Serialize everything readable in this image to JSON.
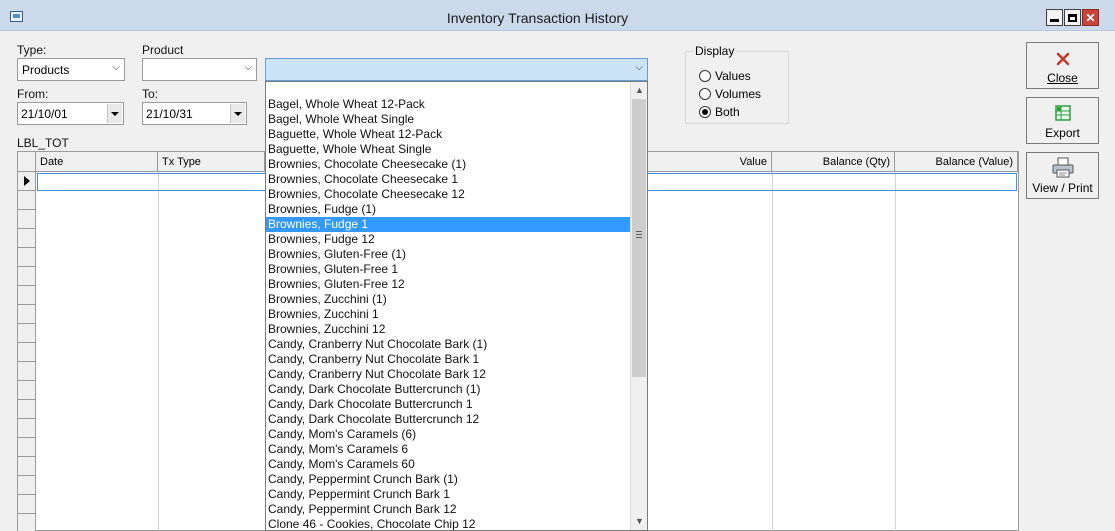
{
  "window": {
    "title": "Inventory Transaction History"
  },
  "filters": {
    "type_label": "Type:",
    "type_value": "Products",
    "product_label": "Product",
    "product_value": "",
    "product2_value": "",
    "from_label": "From:",
    "from_value": "21/10/01",
    "to_label": "To:",
    "to_value": "21/10/31"
  },
  "display": {
    "legend": "Display",
    "options": [
      "Values",
      "Volumes",
      "Both"
    ],
    "selected": "Both"
  },
  "total_label": "LBL_TOT",
  "grid": {
    "columns": [
      "Date",
      "Tx Type",
      "Value",
      "Balance (Qty)",
      "Balance (Value)"
    ]
  },
  "dropdown": {
    "selected": "Brownies, Fudge 1",
    "items": [
      "",
      "Bagel, Whole Wheat 12-Pack",
      "Bagel, Whole Wheat Single",
      "Baguette, Whole Wheat 12-Pack",
      "Baguette, Whole Wheat Single",
      "Brownies, Chocolate Cheesecake (1)",
      "Brownies, Chocolate Cheesecake 1",
      "Brownies, Chocolate Cheesecake 12",
      "Brownies, Fudge (1)",
      "Brownies, Fudge 1",
      "Brownies, Fudge 12",
      "Brownies, Gluten-Free  (1)",
      "Brownies, Gluten-Free  1",
      "Brownies, Gluten-Free  12",
      "Brownies, Zucchini  (1)",
      "Brownies, Zucchini  1",
      "Brownies, Zucchini  12",
      "Candy, Cranberry Nut Chocolate Bark (1)",
      "Candy, Cranberry Nut Chocolate Bark 1",
      "Candy, Cranberry Nut Chocolate Bark 12",
      "Candy, Dark Chocolate Buttercrunch (1)",
      "Candy, Dark Chocolate Buttercrunch 1",
      "Candy, Dark Chocolate Buttercrunch 12",
      "Candy, Mom's Caramels (6)",
      "Candy, Mom's Caramels 6",
      "Candy, Mom's Caramels 60",
      "Candy, Peppermint Crunch Bark (1)",
      "Candy, Peppermint Crunch Bark 1",
      "Candy, Peppermint Crunch Bark 12",
      "Clone 46 - Cookies, Chocolate Chip 12"
    ]
  },
  "buttons": {
    "close": "Close",
    "export": "Export",
    "view_print": "View / Print"
  },
  "colors": {
    "titlebar": "#cbd9ea",
    "selection": "#3399ff",
    "active_combo": "#cce4f7",
    "close_icon": "#c0392b",
    "export_icon": "#2e9e3e"
  }
}
